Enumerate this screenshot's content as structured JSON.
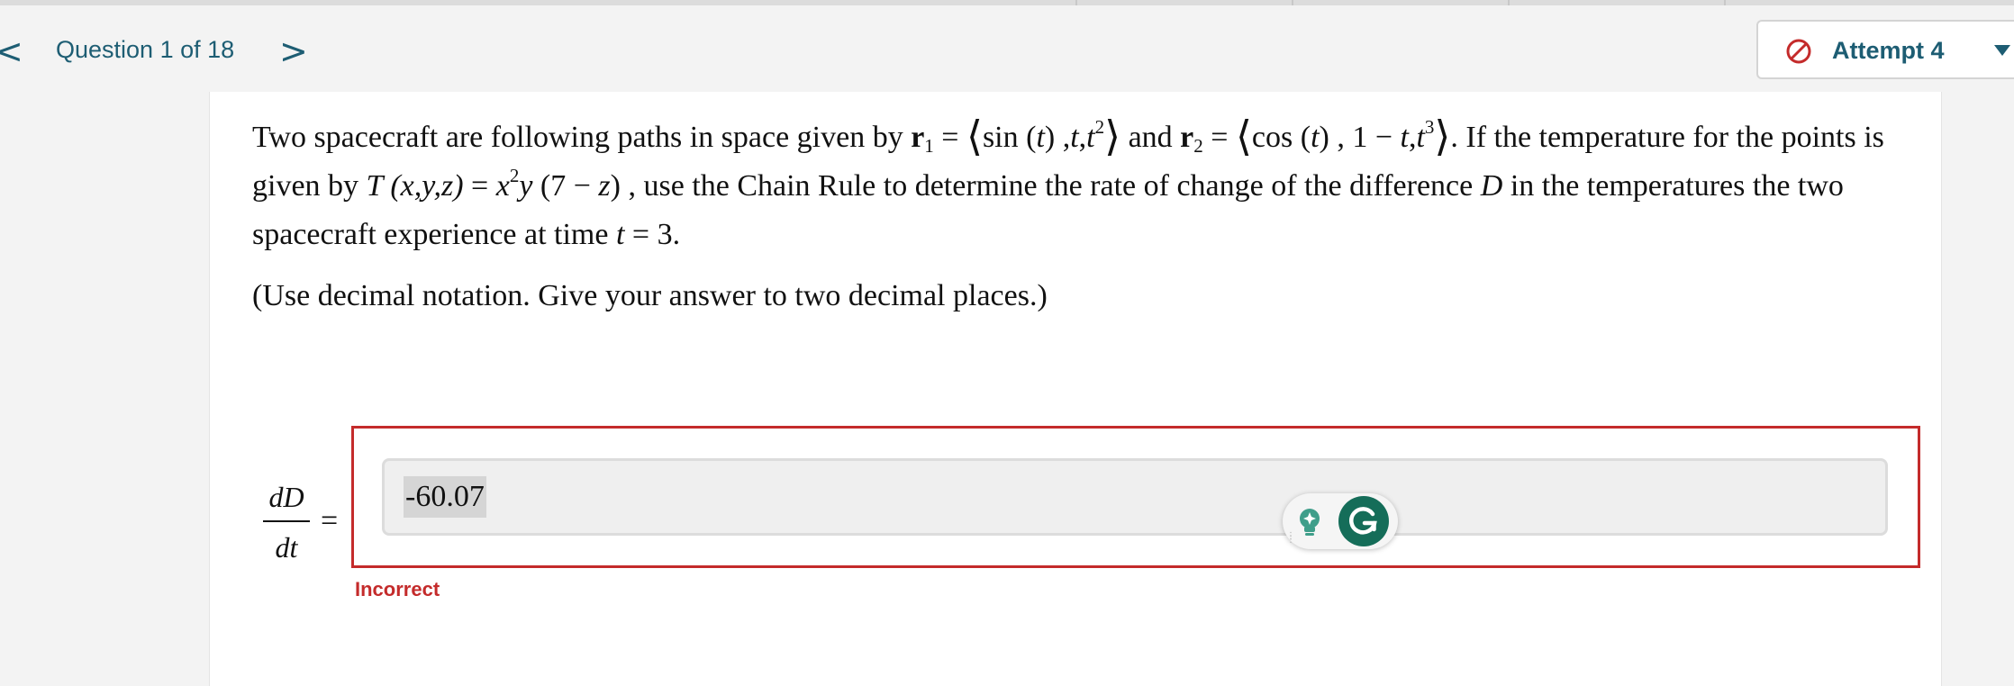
{
  "nav": {
    "prev_glyph": "<",
    "next_glyph": ">",
    "question_counter": "Question 1 of 18"
  },
  "attempt": {
    "label": "Attempt 4",
    "icon": "prohibited-icon",
    "icon_color": "#c42b2b"
  },
  "question": {
    "text_1": "Two spacecraft are following paths in space given by",
    "r1": "r",
    "r1_sub": "1",
    "eq1": " = ",
    "r1_vec_a": "sin (",
    "r1_vec_t1": "t",
    "r1_vec_b": ") ,",
    "r1_vec_t2": "t",
    "r1_vec_c": ",",
    "r1_vec_t3": "t",
    "r1_vec_exp": "2",
    "and": " and ",
    "r2": "r",
    "r2_sub": "2",
    "eq2": " = ",
    "r2_vec_a": "cos (",
    "r2_vec_t1": "t",
    "r2_vec_b": ") , 1 − ",
    "r2_vec_t2": "t",
    "r2_vec_c": ",",
    "r2_vec_t3": "t",
    "r2_vec_exp": "3",
    "text_2": ". If the temperature for the points is given by",
    "T": "T",
    "args": " (x,y,z)",
    "eq3": " = ",
    "x": "x",
    "x_exp": "2",
    "y": "y",
    "factor": " (7 − ",
    "z": "z",
    "close": ") ,",
    "text_3": " use the Chain Rule to determine the rate of change of the difference",
    "D": "D",
    "text_4": " in the temperatures the two spacecraft experience at time",
    "t": "t",
    "eq4": " = 3.",
    "langle": "⟨",
    "rangle": "⟩"
  },
  "instruction": "(Use decimal notation. Give your answer to two decimal places.)",
  "answer": {
    "lhs_numerator": "dD",
    "lhs_denominator": "dt",
    "equals": "=",
    "value": "-60.07",
    "status": "Incorrect",
    "status_color": "#c42b2b"
  },
  "widget": {
    "bulb_icon": "lightbulb-icon",
    "grammarly_icon": "grammarly-icon",
    "grammarly_color": "#156d59"
  }
}
